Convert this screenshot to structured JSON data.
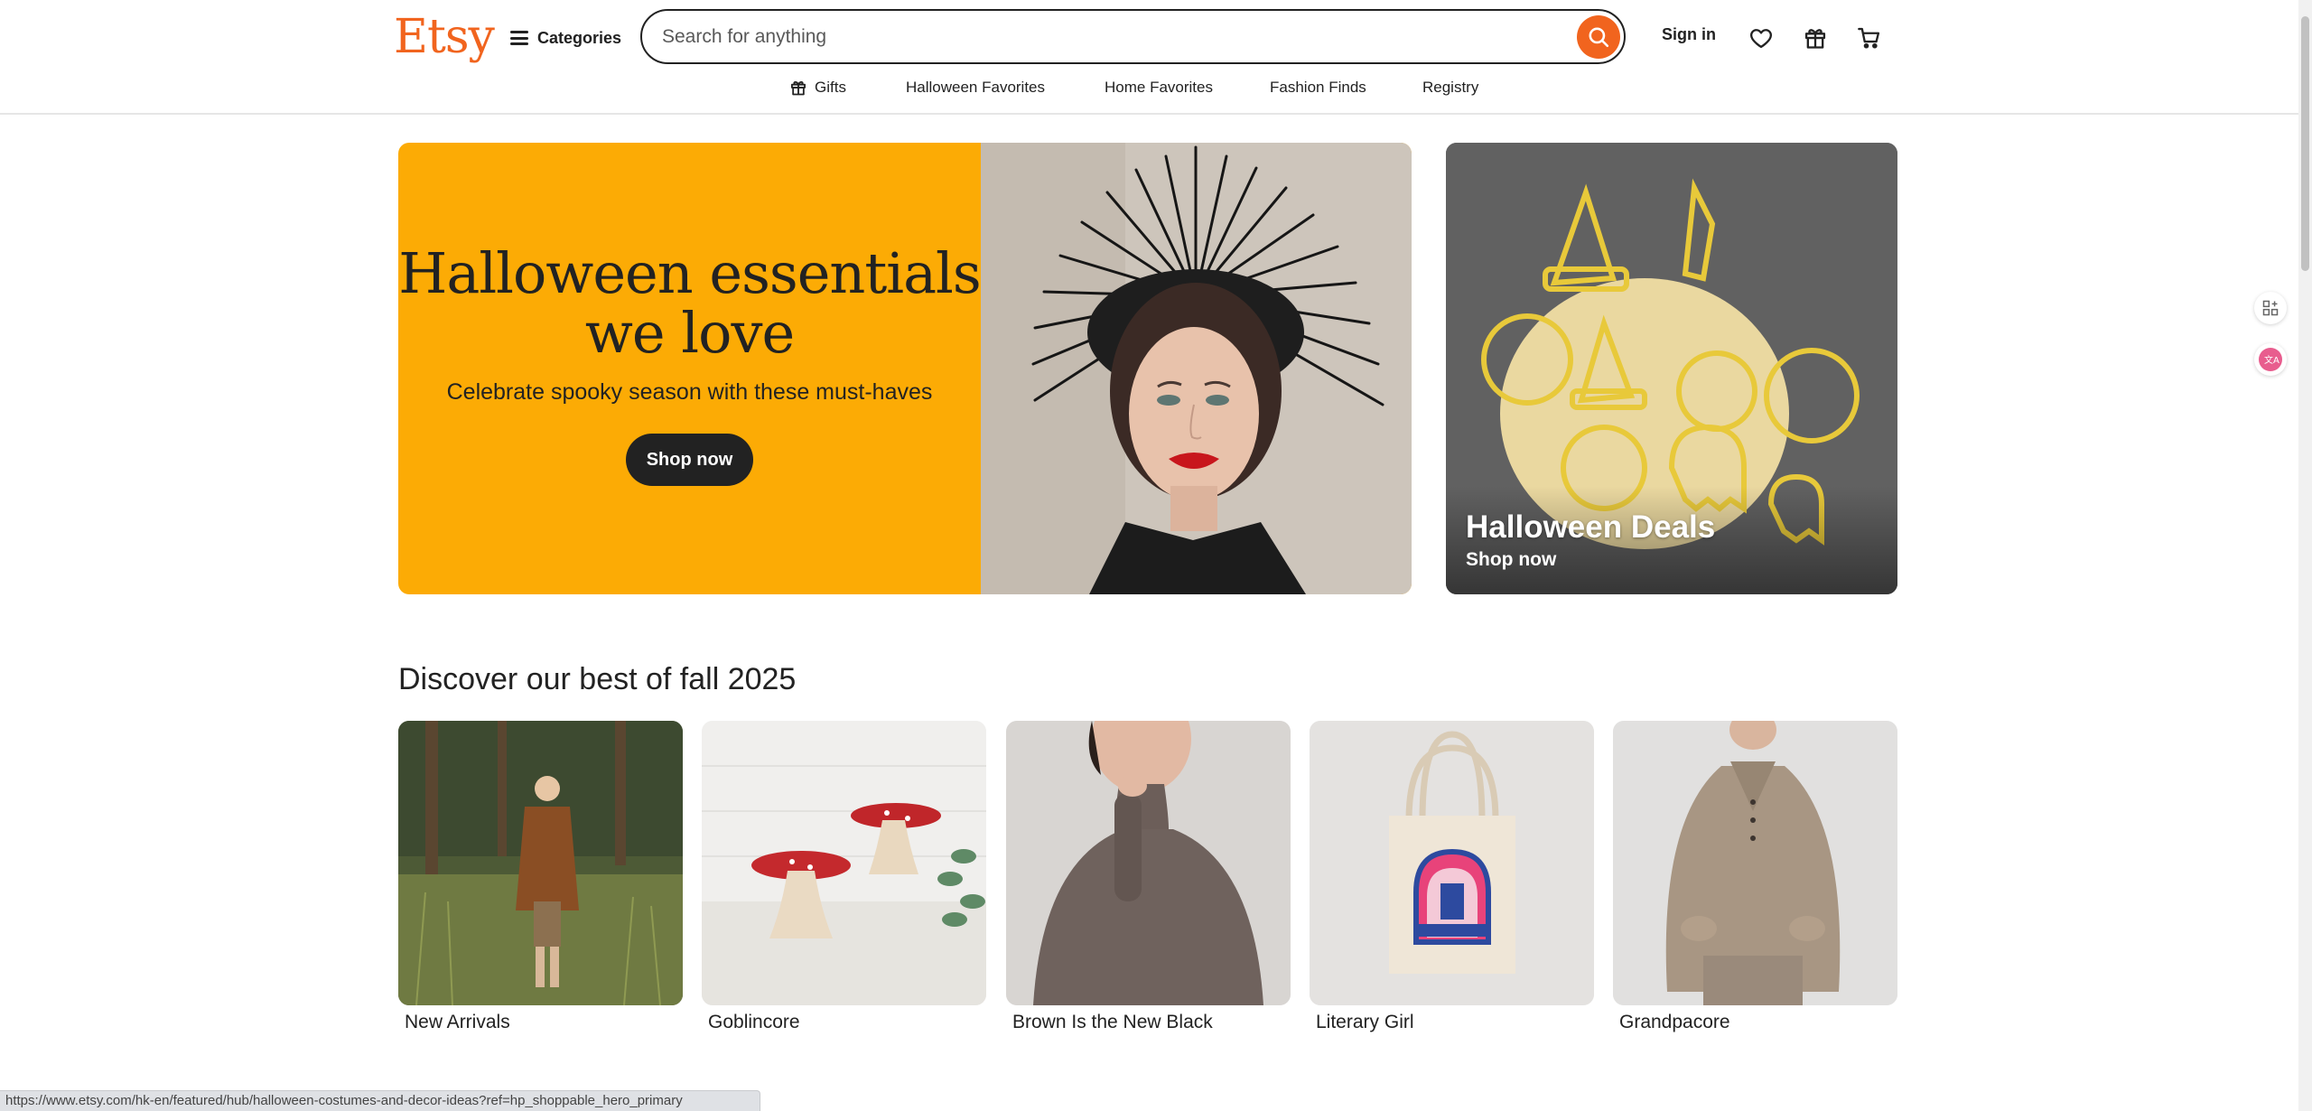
{
  "header": {
    "logo": "Etsy",
    "categories_label": "Categories",
    "search_placeholder": "Search for anything",
    "signin_label": "Sign in"
  },
  "subnav": {
    "items": [
      {
        "label": "Gifts",
        "icon": "gift-icon"
      },
      {
        "label": "Halloween Favorites"
      },
      {
        "label": "Home Favorites"
      },
      {
        "label": "Fashion Finds"
      },
      {
        "label": "Registry"
      }
    ]
  },
  "hero": {
    "title": "Halloween essentials we love",
    "subtitle": "Celebrate spooky season with these must-haves",
    "button_label": "Shop now",
    "bg_color": "#fcab05"
  },
  "deal": {
    "title": "Halloween Deals",
    "subtitle": "Shop now"
  },
  "discover": {
    "title": "Discover our best of fall 2025",
    "tiles": [
      {
        "label": "New Arrivals"
      },
      {
        "label": "Goblincore"
      },
      {
        "label": "Brown Is the New Black"
      },
      {
        "label": "Literary Girl"
      },
      {
        "label": "Grandpacore"
      }
    ]
  },
  "status_url": "https://www.etsy.com/hk-en/featured/hub/halloween-costumes-and-decor-ideas?ref=hp_shoppable_hero_primary",
  "colors": {
    "brand_orange": "#f1641e",
    "hero_yellow": "#fcab05",
    "text_dark": "#222222"
  }
}
